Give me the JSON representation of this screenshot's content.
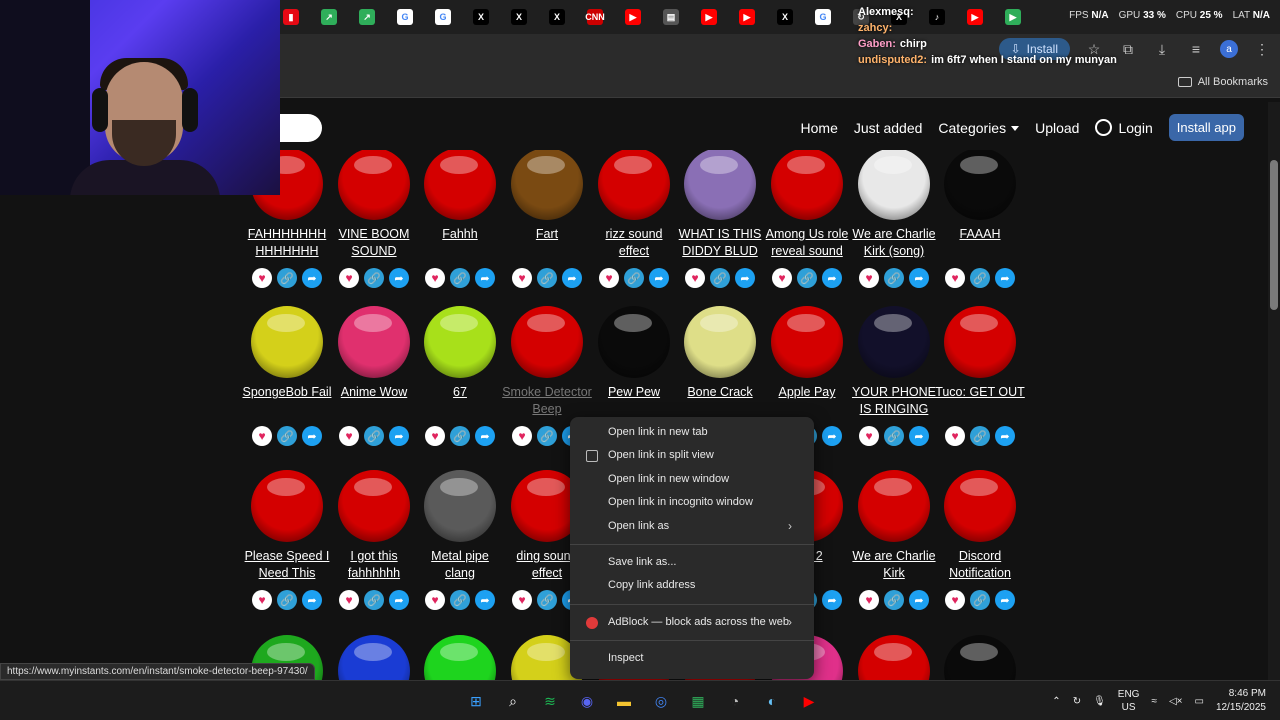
{
  "browser": {
    "tabs": [
      {
        "icon": "netflix-like-icon",
        "color": "#e50914",
        "glyph": "▮"
      },
      {
        "icon": "trend-icon",
        "color": "#2fae5a",
        "glyph": "↗"
      },
      {
        "icon": "trend-icon",
        "color": "#2fae5a",
        "glyph": "↗"
      },
      {
        "icon": "google-icon",
        "color": "#ffffff",
        "glyph": "G"
      },
      {
        "icon": "google-icon",
        "color": "#ffffff",
        "glyph": "G"
      },
      {
        "icon": "x-icon",
        "color": "#000000",
        "glyph": "X"
      },
      {
        "icon": "x-icon",
        "color": "#000000",
        "glyph": "X"
      },
      {
        "icon": "x-icon",
        "color": "#000000",
        "glyph": "X"
      },
      {
        "icon": "cnn-icon",
        "color": "#cc0000",
        "glyph": "CNN"
      },
      {
        "icon": "youtube-icon",
        "color": "#ff0000",
        "glyph": "▶"
      },
      {
        "icon": "gift-icon",
        "color": "#555555",
        "glyph": "▤"
      },
      {
        "icon": "youtube-icon",
        "color": "#ff0000",
        "glyph": "▶"
      },
      {
        "icon": "youtube-icon",
        "color": "#ff0000",
        "glyph": "▶"
      },
      {
        "icon": "x-icon",
        "color": "#000000",
        "glyph": "X"
      },
      {
        "icon": "google-icon",
        "color": "#ffffff",
        "glyph": "G"
      },
      {
        "icon": "refresh-icon",
        "color": "#444444",
        "glyph": "↻"
      },
      {
        "icon": "x-icon",
        "color": "#000000",
        "glyph": "X"
      },
      {
        "icon": "tiktok-icon",
        "color": "#000000",
        "glyph": "♪"
      },
      {
        "icon": "youtube-icon",
        "color": "#ff0000",
        "glyph": "▶"
      },
      {
        "icon": "play-icon",
        "color": "#2fae5a",
        "glyph": "▶"
      }
    ],
    "stats": {
      "fps_label": "FPS",
      "fps": "N/A",
      "gpu_label": "GPU",
      "gpu": "33 %",
      "cpu_label": "CPU",
      "cpu": "25 %",
      "lat_label": "LAT",
      "lat": "N/A"
    },
    "install_label": "Install",
    "all_bookmarks": "All Bookmarks",
    "status_url": "https://www.myinstants.com/en/instant/smoke-detector-beep-97430/"
  },
  "chat": [
    {
      "user": "Alexmesq:",
      "msg": ""
    },
    {
      "user": "zahcy:",
      "msg": ""
    },
    {
      "user": "Gaben:",
      "msg": "chirp"
    },
    {
      "user": "undisputed2:",
      "msg": "im 6ft7 when I stand on my munyan"
    }
  ],
  "site": {
    "nav": {
      "home": "Home",
      "just_added": "Just added",
      "categories": "Categories",
      "upload": "Upload",
      "login": "Login",
      "install_app": "Install app"
    },
    "rows": [
      [
        {
          "label": "FAHHHHHHH HHHHHHH",
          "color": "#d40000"
        },
        {
          "label": "VINE BOOM SOUND",
          "color": "#d40000"
        },
        {
          "label": "Fahhh",
          "color": "#d40000"
        },
        {
          "label": "Fart",
          "color": "#7a4a12"
        },
        {
          "label": "rizz sound effect",
          "color": "#d40000"
        },
        {
          "label": "WHAT IS THIS DIDDY BLUD",
          "color": "#8a6fb5"
        },
        {
          "label": "Among Us role reveal sound",
          "color": "#d40000"
        },
        {
          "label": "We are Charlie Kirk (song)",
          "color": "#e8e8e8"
        },
        {
          "label": "FAAAH",
          "color": "#0a0a0a"
        }
      ],
      [
        {
          "label": "SpongeBob Fail",
          "color": "#d4d01a"
        },
        {
          "label": "Anime Wow",
          "color": "#e0306e"
        },
        {
          "label": "67",
          "color": "#a8e01a"
        },
        {
          "label": "Smoke Detector Beep",
          "color": "#d40000"
        },
        {
          "label": "Pew Pew",
          "color": "#0a0a0a"
        },
        {
          "label": "Bone Crack",
          "color": "#dede88"
        },
        {
          "label": "Apple Pay",
          "color": "#d40000"
        },
        {
          "label": "YOUR PHONE IS RINGING",
          "color": "#12102a"
        },
        {
          "label": "Tuco: GET OUT",
          "color": "#d40000"
        }
      ],
      [
        {
          "label": "Please Speed I Need This",
          "color": "#d40000"
        },
        {
          "label": "I got this fahhhhhh",
          "color": "#d40000"
        },
        {
          "label": "Metal pipe clang",
          "color": "#5a5a5a"
        },
        {
          "label": "ding sound effect",
          "color": "#d40000"
        },
        {
          "label": "",
          "color": "#d40000"
        },
        {
          "label": "",
          "color": "#d40000"
        },
        {
          "label": "ong 2",
          "color": "#d40000"
        },
        {
          "label": "We are Charlie Kirk",
          "color": "#d40000"
        },
        {
          "label": "Discord Notification",
          "color": "#d40000"
        }
      ],
      [
        {
          "label": "",
          "color": "#1ea81e"
        },
        {
          "label": "",
          "color": "#1a3cd4"
        },
        {
          "label": "",
          "color": "#1ed41e"
        },
        {
          "label": "",
          "color": "#d4d01a"
        },
        {
          "label": "",
          "color": "#d40000"
        },
        {
          "label": "",
          "color": "#d40000"
        },
        {
          "label": "",
          "color": "#e0308a"
        },
        {
          "label": "",
          "color": "#d40000"
        },
        {
          "label": "",
          "color": "#0a0a0a"
        }
      ]
    ]
  },
  "context_menu": {
    "items": [
      {
        "label": "Open link in new tab",
        "icon": "",
        "arrow": false
      },
      {
        "label": "Open link in split view",
        "icon": "split-view-icon",
        "arrow": false
      },
      {
        "label": "Open link in new window",
        "icon": "",
        "arrow": false
      },
      {
        "label": "Open link in incognito window",
        "icon": "",
        "arrow": false
      },
      {
        "label": "Open link as",
        "icon": "",
        "arrow": true
      },
      {
        "sep": true
      },
      {
        "label": "Save link as...",
        "icon": "",
        "arrow": false
      },
      {
        "label": "Copy link address",
        "icon": "",
        "arrow": false
      },
      {
        "sep": true
      },
      {
        "label": "AdBlock — block ads across the web",
        "icon": "adblock-icon",
        "arrow": true
      },
      {
        "sep": true
      },
      {
        "label": "Inspect",
        "icon": "",
        "arrow": false
      }
    ]
  },
  "taskbar": {
    "apps": [
      {
        "name": "windows-start-icon",
        "color": "#3aa0ff",
        "glyph": "⊞"
      },
      {
        "name": "search-icon",
        "color": "#ffffff",
        "glyph": "⌕"
      },
      {
        "name": "spotify-icon",
        "color": "#1db954",
        "glyph": "≋"
      },
      {
        "name": "discord-icon",
        "color": "#5865f2",
        "glyph": "◉"
      },
      {
        "name": "file-explorer-icon",
        "color": "#f4c430",
        "glyph": "▬"
      },
      {
        "name": "chrome-icon",
        "color": "#4285f4",
        "glyph": "◎"
      },
      {
        "name": "app-icon",
        "color": "#2fae5a",
        "glyph": "▦"
      },
      {
        "name": "app-icon",
        "color": "#bbbbbb",
        "glyph": "◔"
      },
      {
        "name": "steam-icon",
        "color": "#66c0f4",
        "glyph": "◐"
      },
      {
        "name": "youtube-icon",
        "color": "#ff0000",
        "glyph": "▶"
      }
    ],
    "lang": "ENG",
    "region": "US",
    "time": "8:46 PM",
    "date": "12/15/2025"
  }
}
